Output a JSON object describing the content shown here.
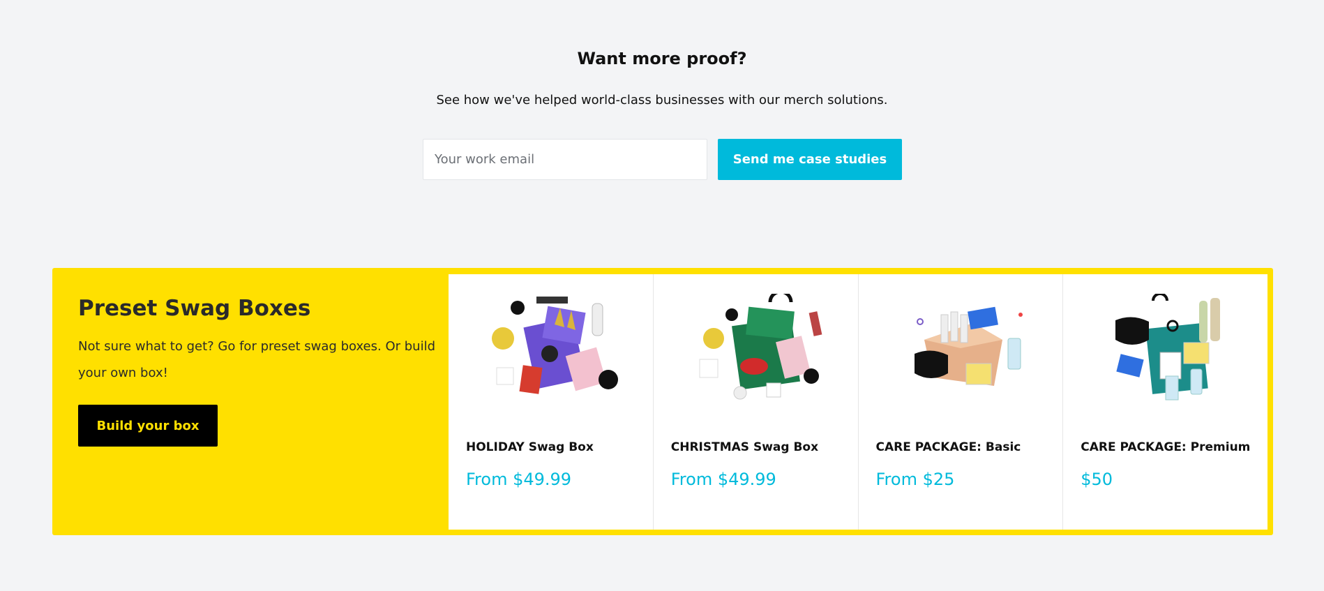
{
  "proof": {
    "title": "Want more proof?",
    "subtitle": "See how we've helped world-class businesses with our merch solutions.",
    "email_placeholder": "Your work email",
    "email_value": "",
    "button_label": "Send me case studies"
  },
  "swag": {
    "title": "Preset Swag Boxes",
    "description": "Not sure what to get? Go for preset swag boxes. Or build your own box!",
    "button_label": "Build your box",
    "products": [
      {
        "name": "HOLIDAY Swag Box",
        "price": "From $49.99",
        "image_icon": "holiday-box-image"
      },
      {
        "name": "CHRISTMAS Swag Box",
        "price": "From $49.99",
        "image_icon": "christmas-box-image"
      },
      {
        "name": "CARE PACKAGE: Basic",
        "price": "From $25",
        "image_icon": "care-basic-image"
      },
      {
        "name": "CARE PACKAGE: Premium",
        "price": "$50",
        "image_icon": "care-premium-image"
      }
    ]
  },
  "colors": {
    "background": "#f3f4f6",
    "accent_cyan": "#00badb",
    "brand_yellow": "#ffe000",
    "black": "#000000"
  }
}
